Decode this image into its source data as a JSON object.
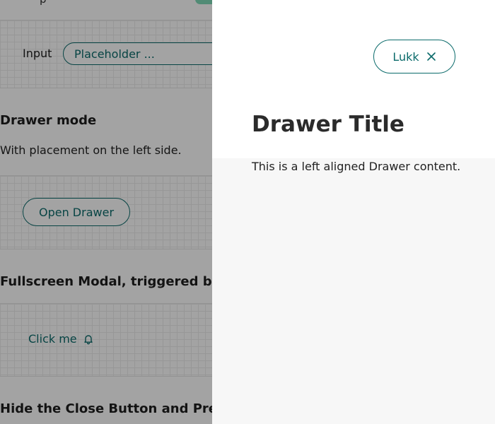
{
  "page": {
    "top_fragment": "p",
    "input_section": {
      "label": "Input",
      "placeholder": "Placeholder ..."
    },
    "drawer_mode": {
      "title": "Drawer mode",
      "description": "With placement on the left side.",
      "open_button_label": "Open Drawer"
    },
    "fullscreen_modal": {
      "title": "Fullscreen Modal, triggered by a t",
      "click_me_label": "Click me",
      "click_me_icon": "bell-icon"
    },
    "hide_close": {
      "title": "Hide the Close Button and Prever"
    }
  },
  "drawer": {
    "close_label": "Lukk",
    "close_icon": "close-icon",
    "title": "Drawer Title",
    "content": "This is a left aligned Drawer content."
  },
  "colors": {
    "accent": "#0b6b6b",
    "overlay": "rgba(0,0,0,0.36)",
    "drawer_body": "#f7f7f7",
    "drawer_header": "#ffffff"
  }
}
